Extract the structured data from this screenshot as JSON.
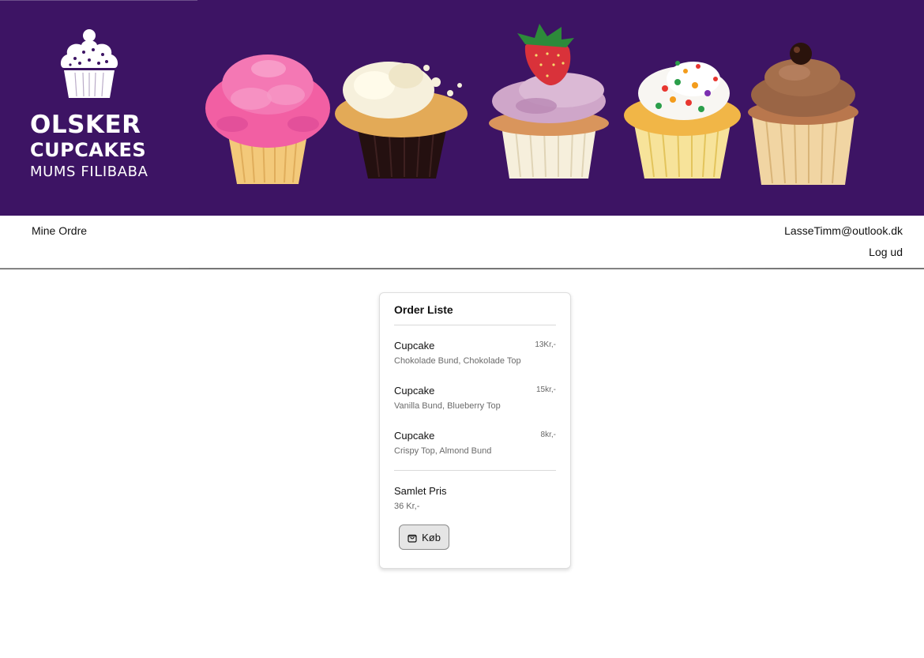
{
  "brand": {
    "line1": "OLSKER",
    "line2": "CUPCAKES",
    "line3": "MUMS FILIBABA",
    "icon": "cupcake-logo-icon",
    "banner_color": "#3d1464"
  },
  "nav": {
    "orders_link": "Mine Ordre",
    "user_email": "LasseTimm@outlook.dk",
    "logout_link": "Log ud"
  },
  "order": {
    "title": "Order Liste",
    "items": [
      {
        "name": "Cupcake",
        "price": "13Kr,-",
        "description": "Chokolade Bund, Chokolade Top"
      },
      {
        "name": "Cupcake",
        "price": "15kr,-",
        "description": "Vanilla Bund, Blueberry Top"
      },
      {
        "name": "Cupcake",
        "price": "8kr,-",
        "description": "Crispy Top, Almond Bund"
      }
    ],
    "total_label": "Samlet Pris",
    "total_value": "36 Kr,-",
    "buy_label": "Køb",
    "buy_icon": "shopping-bag-icon"
  }
}
